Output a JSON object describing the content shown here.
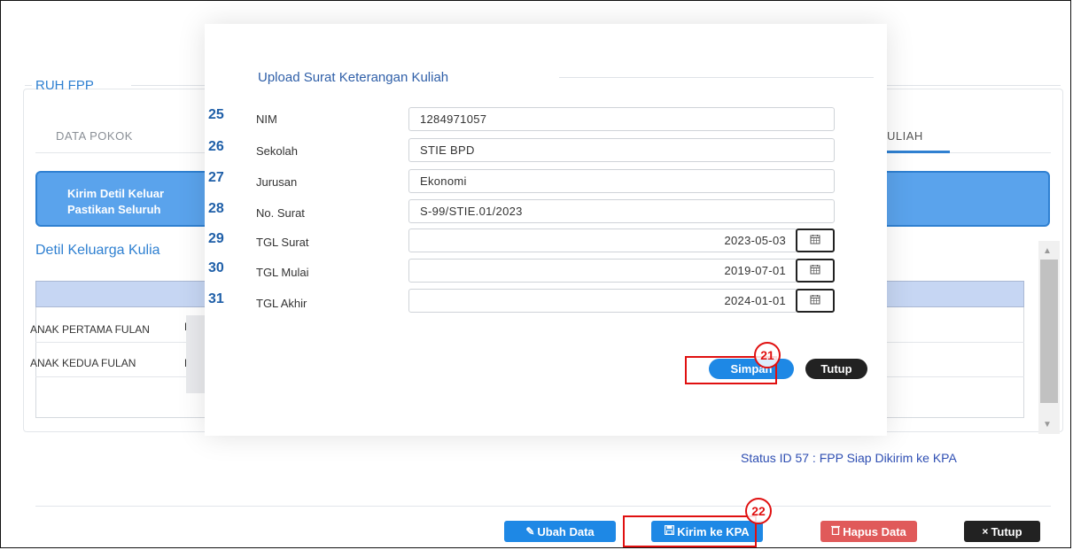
{
  "background": {
    "panel_title": "RUH FPP",
    "tabs": {
      "first": "DATA POKOK",
      "active_partial": "ULIAH"
    },
    "alert": {
      "line1": "Kirim Detil Keluar",
      "line2": "Pastikan Seluruh"
    },
    "section_title": "Detil Keluarga Kulia",
    "rows": [
      {
        "name": "ANAK PERTAMA FULAN",
        "col2": "Dz"
      },
      {
        "name": "ANAK KEDUA FULAN",
        "col2": "Dz"
      }
    ],
    "status": "Status ID 57 : FPP Siap Dikirim ke KPA",
    "buttons": {
      "ubah": "Ubah Data",
      "kirim": "Kirim ke KPA",
      "hapus": "Hapus Data",
      "tutup": "Tutup"
    }
  },
  "modal": {
    "title": "Upload Surat Keterangan Kuliah",
    "fields": [
      {
        "num": "25",
        "label": "NIM",
        "value": "1284971057"
      },
      {
        "num": "26",
        "label": "Sekolah",
        "value": "STIE BPD"
      },
      {
        "num": "27",
        "label": "Jurusan",
        "value": "Ekonomi"
      },
      {
        "num": "28",
        "label": "No. Surat",
        "value": "S-99/STIE.01/2023"
      },
      {
        "num": "29",
        "label": "TGL Surat",
        "value": "2023-05-03"
      },
      {
        "num": "30",
        "label": "TGL Mulai",
        "value": "2019-07-01"
      },
      {
        "num": "31",
        "label": "TGL Akhir",
        "value": "2024-01-01"
      }
    ],
    "buttons": {
      "simpan": "Simpan",
      "tutup": "Tutup"
    }
  },
  "annotations": {
    "marker_21": "21",
    "marker_22": "22"
  },
  "colors": {
    "accent": "#2f80d1",
    "button_blue": "#1e88e5",
    "button_red": "#e05a5a",
    "button_dark": "#222222",
    "annotation_red": "#e01010"
  },
  "icons": {
    "calendar": "calendar-icon",
    "edit": "edit-icon",
    "save": "save-icon",
    "trash": "trash-icon",
    "close": "close-icon"
  }
}
